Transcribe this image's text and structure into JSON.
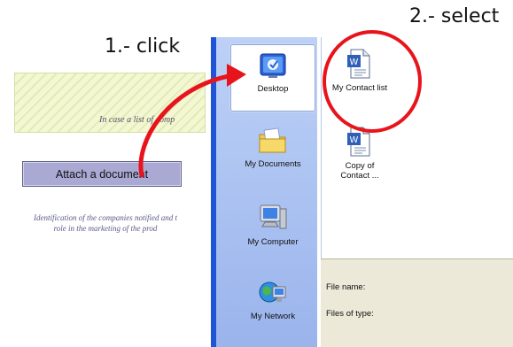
{
  "annotations": {
    "step1": "1.- click",
    "step2": "2.- select"
  },
  "form": {
    "note_text": "In case a list of comp",
    "attach_button": "Attach a document",
    "identification_line1": "Identification of the companies notified and t",
    "identification_line2": "role in the marketing of the prod"
  },
  "dialog": {
    "places": [
      {
        "label": "Desktop",
        "icon": "desktop-icon"
      },
      {
        "label": "My Documents",
        "icon": "my-documents-icon"
      },
      {
        "label": "My Computer",
        "icon": "my-computer-icon"
      },
      {
        "label": "My Network",
        "icon": "my-network-icon"
      }
    ],
    "files": [
      {
        "label": "My Contact list",
        "icon": "word-document-icon"
      },
      {
        "label_line1": "Copy of",
        "label_line2": "Contact ...",
        "icon": "word-document-icon"
      }
    ],
    "file_name_label": "File name:",
    "files_of_type_label": "Files of type:"
  },
  "colors": {
    "annotation_red": "#e8141c",
    "button_fill": "#a9a9d4",
    "places_bar": "#9ab4ec"
  }
}
